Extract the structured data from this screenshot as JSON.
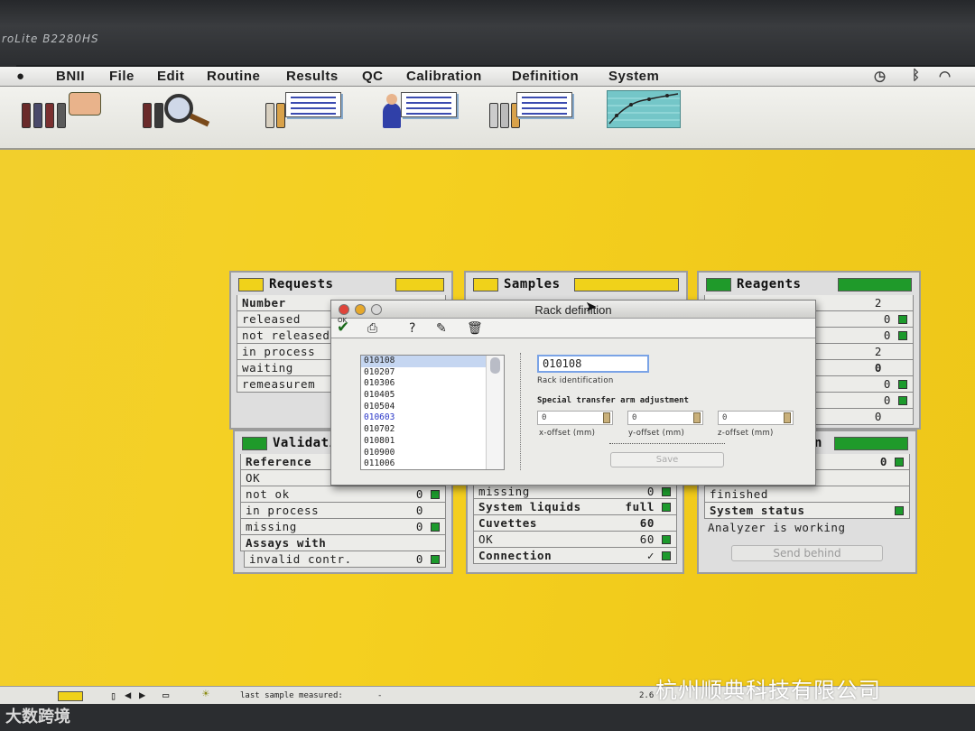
{
  "monitor": {
    "model": "roLite B2280HS"
  },
  "menubar": {
    "app": "BNII",
    "items": [
      "File",
      "Edit",
      "Routine",
      "Results",
      "QC",
      "Calibration",
      "Definition",
      "System"
    ]
  },
  "toolbar": {
    "icons": [
      "rack-loading-icon",
      "sample-inspect-icon",
      "requests-list-icon",
      "user-list-icon",
      "reagents-list-icon",
      "calibration-curve-icon"
    ]
  },
  "requests": {
    "title": "Requests",
    "header": "Number",
    "rows": [
      "released",
      "not released",
      "in process",
      "waiting",
      "remeasurem"
    ]
  },
  "samples": {
    "title": "Samples"
  },
  "reagents": {
    "title": "Reagents",
    "values": [
      "2",
      "0",
      "0",
      "2",
      "0",
      "0",
      "0",
      "0"
    ]
  },
  "validation": {
    "title": "Validatio",
    "header": "Reference",
    "rows": [
      {
        "label": "OK",
        "value": ""
      },
      {
        "label": "not ok",
        "value": "0"
      },
      {
        "label": "in process",
        "value": "0"
      },
      {
        "label": "missing",
        "value": "0"
      }
    ],
    "assays_header": "Assays with",
    "assays_row": {
      "label": "invalid contr.",
      "value": "0"
    }
  },
  "samples_bottom": {
    "rows": [
      {
        "label": "missing",
        "value": "0"
      },
      {
        "label": "System liquids",
        "value": "full"
      },
      {
        "label": "Cuvettes",
        "value": "60"
      },
      {
        "label": "OK",
        "value": "60"
      },
      {
        "label": "Connection",
        "value": "✓"
      }
    ]
  },
  "system_panel": {
    "title": "n",
    "top_value": "0",
    "finished_label": "finished",
    "status_label": "System status",
    "status_text": "Analyzer is working",
    "send_behind": "Send behind"
  },
  "dialog": {
    "title": "Rack definition",
    "ok_label": "OK",
    "racks": [
      "010108",
      "010207",
      "010306",
      "010405",
      "010504",
      "010603",
      "010702",
      "010801",
      "010900",
      "011006"
    ],
    "rack_id_value": "010108",
    "rack_id_label": "Rack identification",
    "arm_title": "Special transfer arm adjustment",
    "offsets": [
      {
        "value": "0",
        "label": "x-offset (mm)"
      },
      {
        "value": "0",
        "label": "y-offset (mm)"
      },
      {
        "value": "0",
        "label": "z-offset (mm)"
      }
    ],
    "save_label": "Save"
  },
  "statusbar": {
    "last_sample": "last sample measured:",
    "last_sample_value": "-",
    "right_value": "2.6"
  },
  "watermarks": {
    "corner": "大数跨境",
    "brand": "杭州顺典科技有限公司"
  }
}
